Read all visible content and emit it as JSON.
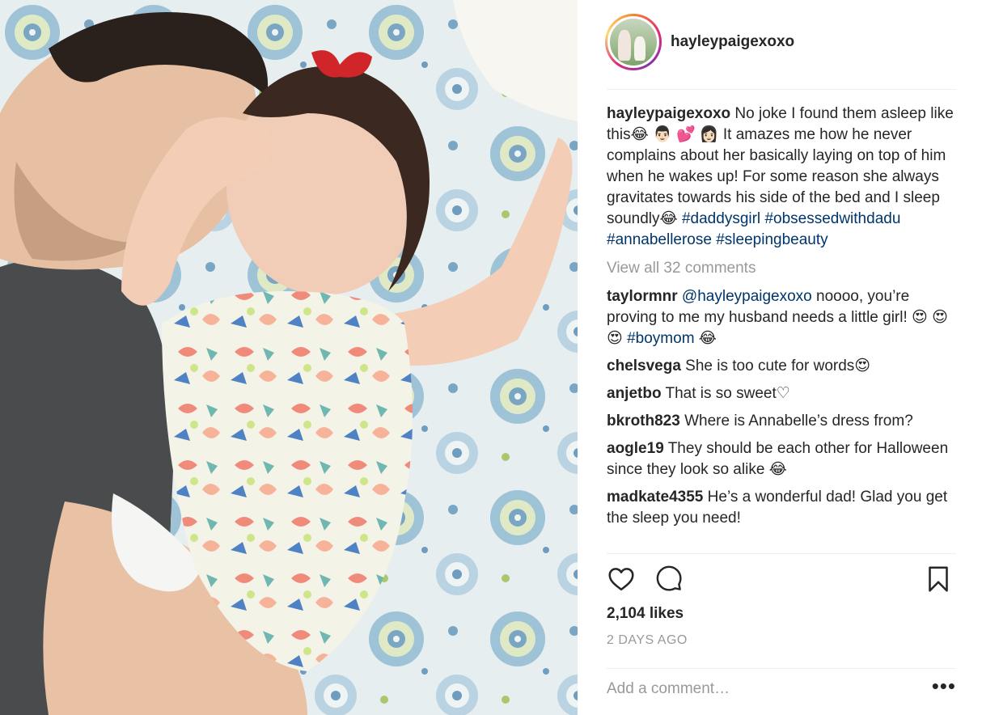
{
  "author": {
    "username": "hayleypaigexoxo"
  },
  "caption": {
    "username": "hayleypaigexoxo",
    "text": " No joke I found them asleep like this😂 👨🏻 💕 👩🏻 It amazes me how he never complains about her basically laying on top of him when he wakes up! For some reason she always gravitates towards his side of the bed and I sleep soundly😂",
    "hashtags": [
      "#daddysgirl",
      "#obsessedwithdadu",
      "#annabellerose",
      "#sleepingbeauty"
    ]
  },
  "view_all_label": "View all 32 comments",
  "comments": [
    {
      "username": "taylormnr",
      "mention": "@hayleypaigexoxo",
      "text": " noooo, you’re proving to me my husband needs a little girl! 😍 😍 😍 ",
      "hashtag": "#boymom",
      "suffix": " 😂"
    },
    {
      "username": "chelsvega",
      "text": " She is too cute for words😍"
    },
    {
      "username": "anjetbo",
      "text": " That is so sweet♡"
    },
    {
      "username": "bkroth823",
      "text": " Where is Annabelle’s dress from?"
    },
    {
      "username": "aogle19",
      "text": " They should be each other for Halloween since they look so alike 😂"
    },
    {
      "username": "madkate4355",
      "text": " He’s a wonderful dad! Glad you get the sleep you need!"
    }
  ],
  "likes": "2,104 likes",
  "date": "2 DAYS AGO",
  "add_comment_placeholder": "Add a comment…",
  "more_label": "•••",
  "icons": {
    "like": "heart-icon",
    "comment": "comment-bubble-icon",
    "save": "bookmark-icon",
    "more": "more-options-icon"
  },
  "colors": {
    "username": "#262626",
    "hashtag": "#003569",
    "muted": "#999999",
    "divider": "#efefef"
  }
}
